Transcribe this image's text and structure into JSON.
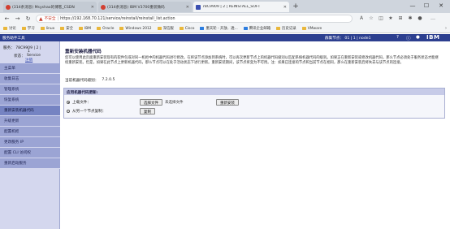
{
  "browser": {
    "tabs": [
      {
        "title": "(314条消息) Msyshao的博客_CSDN",
        "active": false
      },
      {
        "title": "(314条消息) IBM V3700重装微码",
        "active": false
      },
      {
        "title": "78C9909 | 2 | REINSTALL_SOFT",
        "active": true
      }
    ],
    "new_tab": "+",
    "window_controls": [
      "—",
      "☐",
      "✕"
    ],
    "address": {
      "warning_label": "不安全",
      "url": "https://192.168.70.121/service/reinstall/reinstall_list.action"
    },
    "bookmarks": [
      "讨论",
      "学习",
      "linux",
      "安全",
      "IBM",
      "Oracle",
      "Windows 2012",
      "深信服",
      "Cisco",
      "墨天轮 - 开放、透...",
      "腾讯企业邮箱",
      "历史记录",
      "VMware"
    ],
    "bookmarks_more": "›"
  },
  "app": {
    "title": "服务助手工具",
    "node_info": "群集节点： 01 | 1 | node1",
    "logo": "IBM"
  },
  "sidebar": {
    "node_line": "服务： 78C9909 | 2 |",
    "node_line2": "1",
    "state_label": "状态：",
    "state_value": "Service",
    "logout": "注销",
    "items": [
      {
        "label": "主菜单",
        "active": false
      },
      {
        "label": "收集日志",
        "active": false
      },
      {
        "label": "管理系统",
        "active": false
      },
      {
        "label": "恢复系统",
        "active": false
      },
      {
        "label": "重新安装机器代码",
        "active": true
      },
      {
        "label": "升级更新",
        "active": false
      },
      {
        "label": "配置机柜",
        "active": false
      },
      {
        "label": "更改服务 IP",
        "active": false
      },
      {
        "label": "配置 CLI 访问权",
        "active": false
      },
      {
        "label": "重新启动服务",
        "active": false
      }
    ]
  },
  "main": {
    "title": "重新安装机器代码",
    "description": "您可以使用此页面重新安装现有的软件包或对同一机柜中的机器代码进行修改。在将该节点添加到系统时，可以再次更新节点上的机器代码级别以匹配系统机器代码的级别。如果正在重新安装或修改机器代码，那么节点必须处于服务状态才能继续重新安装。但是，如果在此节点上更新机器代码，那么节点可以在处于活动状态下进行更新。重新安装期间，该节点将变为不可用。注：如果已连接的节点和当前节点在相同，那么在重新安装后将失去与该节点的连接。",
    "current_level_label": "当前机器代码级别：",
    "current_level_value": "7.2.0.5",
    "form": {
      "header": "应用机器代码更新:",
      "upload_label": "上载文件：",
      "choose_file": "选择文件",
      "no_file": "未选择文件",
      "reinstall_button": "重新安装",
      "from_other_label": "从另一个节点复制：",
      "copy_button": "复制"
    }
  }
}
